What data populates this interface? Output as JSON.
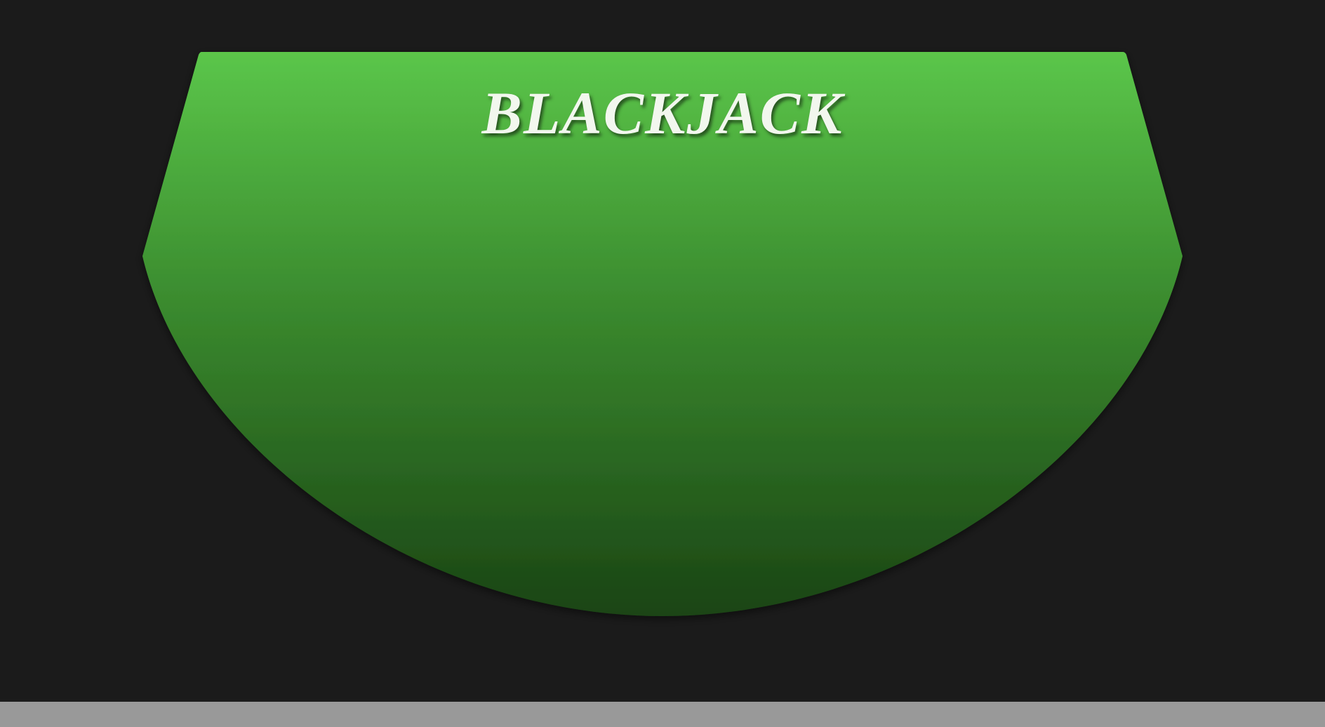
{
  "game": {
    "title": "BLACKJACK"
  },
  "theme": {
    "background": "#1b1b1b",
    "felt_top": "#5bc64a",
    "felt_bottom": "#1a4414",
    "title_color": "#f2f7ee",
    "footer_bar": "#999999"
  }
}
